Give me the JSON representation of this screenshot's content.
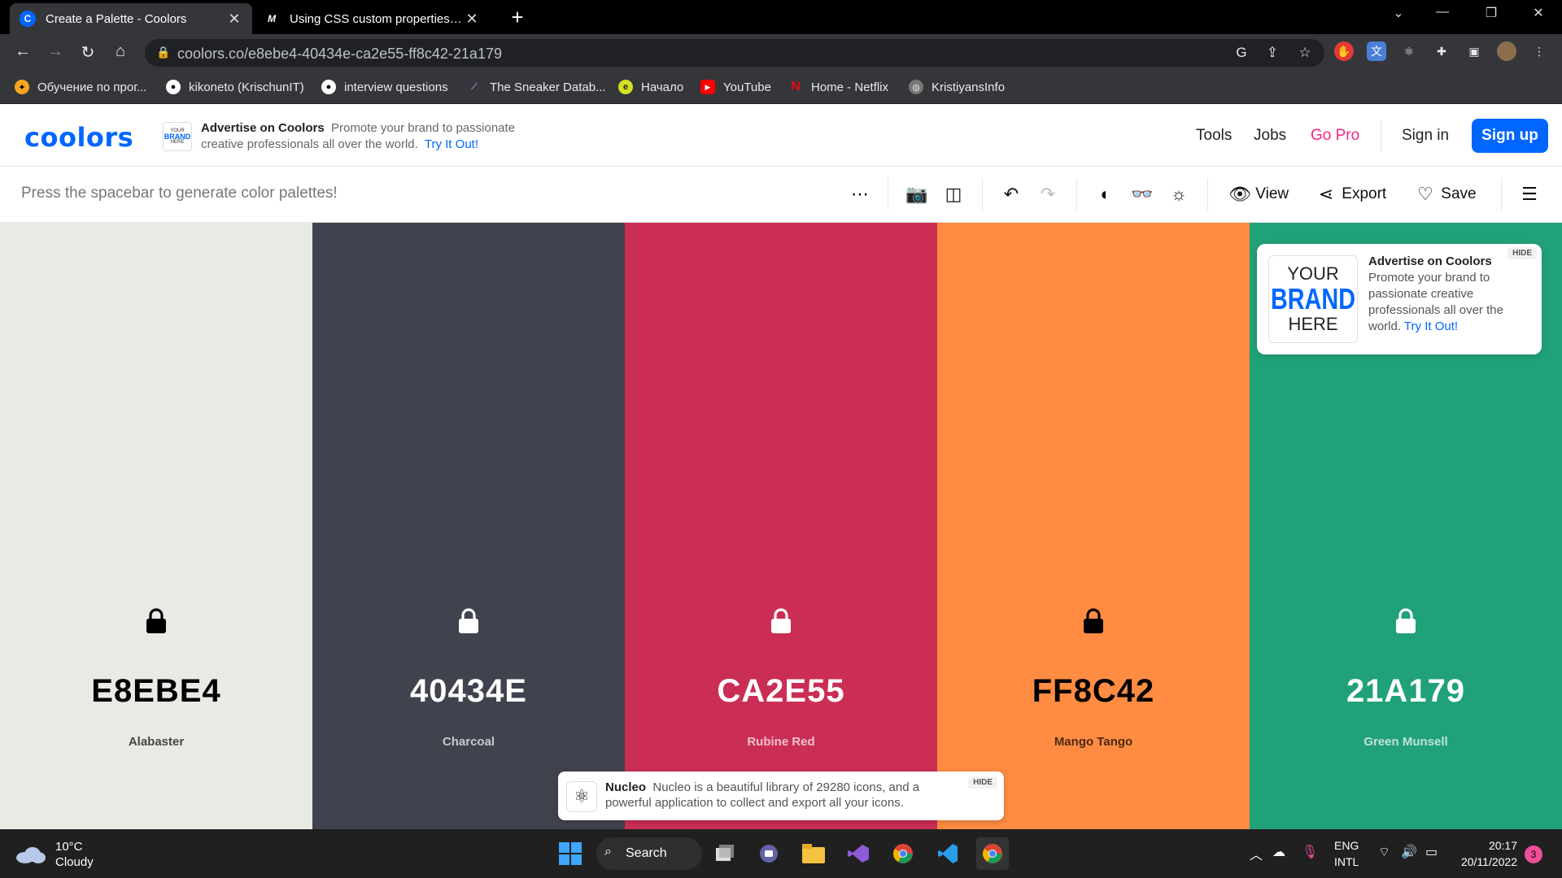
{
  "browser": {
    "tabs": [
      {
        "title": "Create a Palette - Coolors",
        "active": true
      },
      {
        "title": "Using CSS custom properties (variables)",
        "active": false
      }
    ],
    "url": "coolors.co/e8ebe4-40434e-ca2e55-ff8c42-21a179",
    "bookmarks": [
      {
        "label": "Обучение по прог..."
      },
      {
        "label": "kikoneto (KrischunIT)"
      },
      {
        "label": "interview questions"
      },
      {
        "label": "The Sneaker Datab..."
      },
      {
        "label": "Начало"
      },
      {
        "label": "YouTube"
      },
      {
        "label": "Home - Netflix"
      },
      {
        "label": "KristiyansInfo"
      }
    ]
  },
  "header": {
    "logo": "coolors",
    "ad": {
      "badge_top": "YOUR",
      "badge_mid": "BRAND",
      "badge_bottom": "HERE",
      "title": "Advertise on Coolors",
      "text": "Promote your brand to passionate creative professionals all over the world.",
      "link": "Try It Out!"
    },
    "nav": {
      "tools": "Tools",
      "jobs": "Jobs",
      "gopro": "Go Pro",
      "signin": "Sign in",
      "signup": "Sign up"
    }
  },
  "toolbar": {
    "hint": "Press the spacebar to generate color palettes!",
    "view": "View",
    "export": "Export",
    "save": "Save"
  },
  "palette": [
    {
      "hex": "E8EBE4",
      "name": "Alabaster",
      "color": "#e8ebe4",
      "text_color": "#000000"
    },
    {
      "hex": "40434E",
      "name": "Charcoal",
      "color": "#40434e",
      "text_color": "#ffffff"
    },
    {
      "hex": "CA2E55",
      "name": "Rubine Red",
      "color": "#ca2e55",
      "text_color": "#ffffff"
    },
    {
      "hex": "FF8C42",
      "name": "Mango Tango",
      "color": "#ff8c42",
      "text_color": "#000000"
    },
    {
      "hex": "21A179",
      "name": "Green Munsell",
      "color": "#21a179",
      "text_color": "#ffffff"
    }
  ],
  "brand_ad": {
    "logo_top": "YOUR",
    "logo_mid": "BRAND",
    "logo_bottom": "HERE",
    "title": "Advertise on Coolors",
    "text": "Promote your brand to passionate creative professionals all over the world.",
    "link": "Try It Out!",
    "hide": "HIDE"
  },
  "nucleo": {
    "title": "Nucleo",
    "text": "Nucleo is a beautiful library of 29280 icons, and a powerful application to collect and export all your icons.",
    "hide": "HIDE"
  },
  "taskbar": {
    "temp": "10°C",
    "weather": "Cloudy",
    "search": "Search",
    "lang1": "ENG",
    "lang2": "INTL",
    "time": "20:17",
    "date": "20/11/2022",
    "notifications": "3"
  },
  "colors": {
    "accent": "#0066ff",
    "gopro": "#f72585"
  }
}
